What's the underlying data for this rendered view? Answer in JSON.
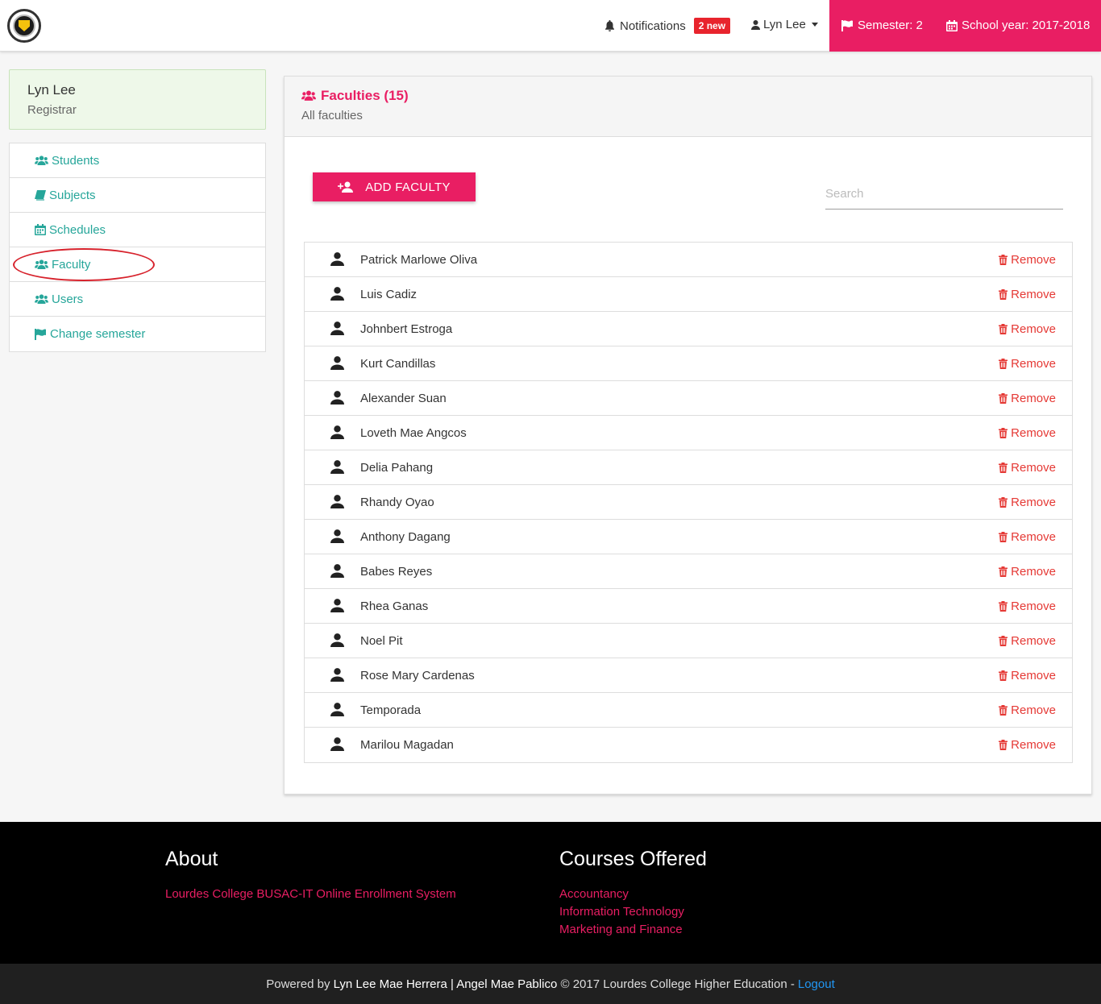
{
  "header": {
    "notifications_label": "Notifications",
    "notifications_badge": "2 new",
    "user_label": "Lyn Lee",
    "semester_label": "Semester: 2",
    "school_year_label": "School year: 2017-2018",
    "accent_color": "#e91e63"
  },
  "profile": {
    "name": "Lyn Lee",
    "role": "Registrar"
  },
  "sidebar": {
    "items": [
      {
        "label": "Students",
        "icon": "users-icon"
      },
      {
        "label": "Subjects",
        "icon": "book-icon"
      },
      {
        "label": "Schedules",
        "icon": "calendar-icon"
      },
      {
        "label": "Faculty",
        "icon": "users-icon"
      },
      {
        "label": "Users",
        "icon": "users-icon"
      },
      {
        "label": "Change semester",
        "icon": "flag-icon"
      }
    ]
  },
  "panel": {
    "title": "Faculties (15)",
    "subtitle": "All faculties",
    "add_button": "ADD FACULTY",
    "search_placeholder": "Search",
    "remove_label": "Remove",
    "faculty": [
      "Patrick Marlowe Oliva",
      "Luis Cadiz",
      "Johnbert Estroga",
      "Kurt Candillas",
      "Alexander Suan",
      "Loveth Mae Angcos",
      "Delia Pahang",
      "Rhandy Oyao",
      "Anthony Dagang",
      "Babes Reyes",
      "Rhea Ganas",
      "Noel Pit",
      "Rose Mary Cardenas",
      "Temporada",
      "Marilou Magadan"
    ]
  },
  "footer": {
    "about_title": "About",
    "about_link": "Lourdes College BUSAC-IT Online Enrollment System",
    "courses_title": "Courses Offered",
    "courses": [
      "Accountancy",
      "Information Technology",
      "Marketing and Finance"
    ],
    "powered_prefix": "Powered by",
    "authors": "Lyn Lee Mae Herrera | Angel Mae Pablico",
    "copyright": "© 2017 Lourdes College Higher Education -",
    "logout": "Logout"
  }
}
